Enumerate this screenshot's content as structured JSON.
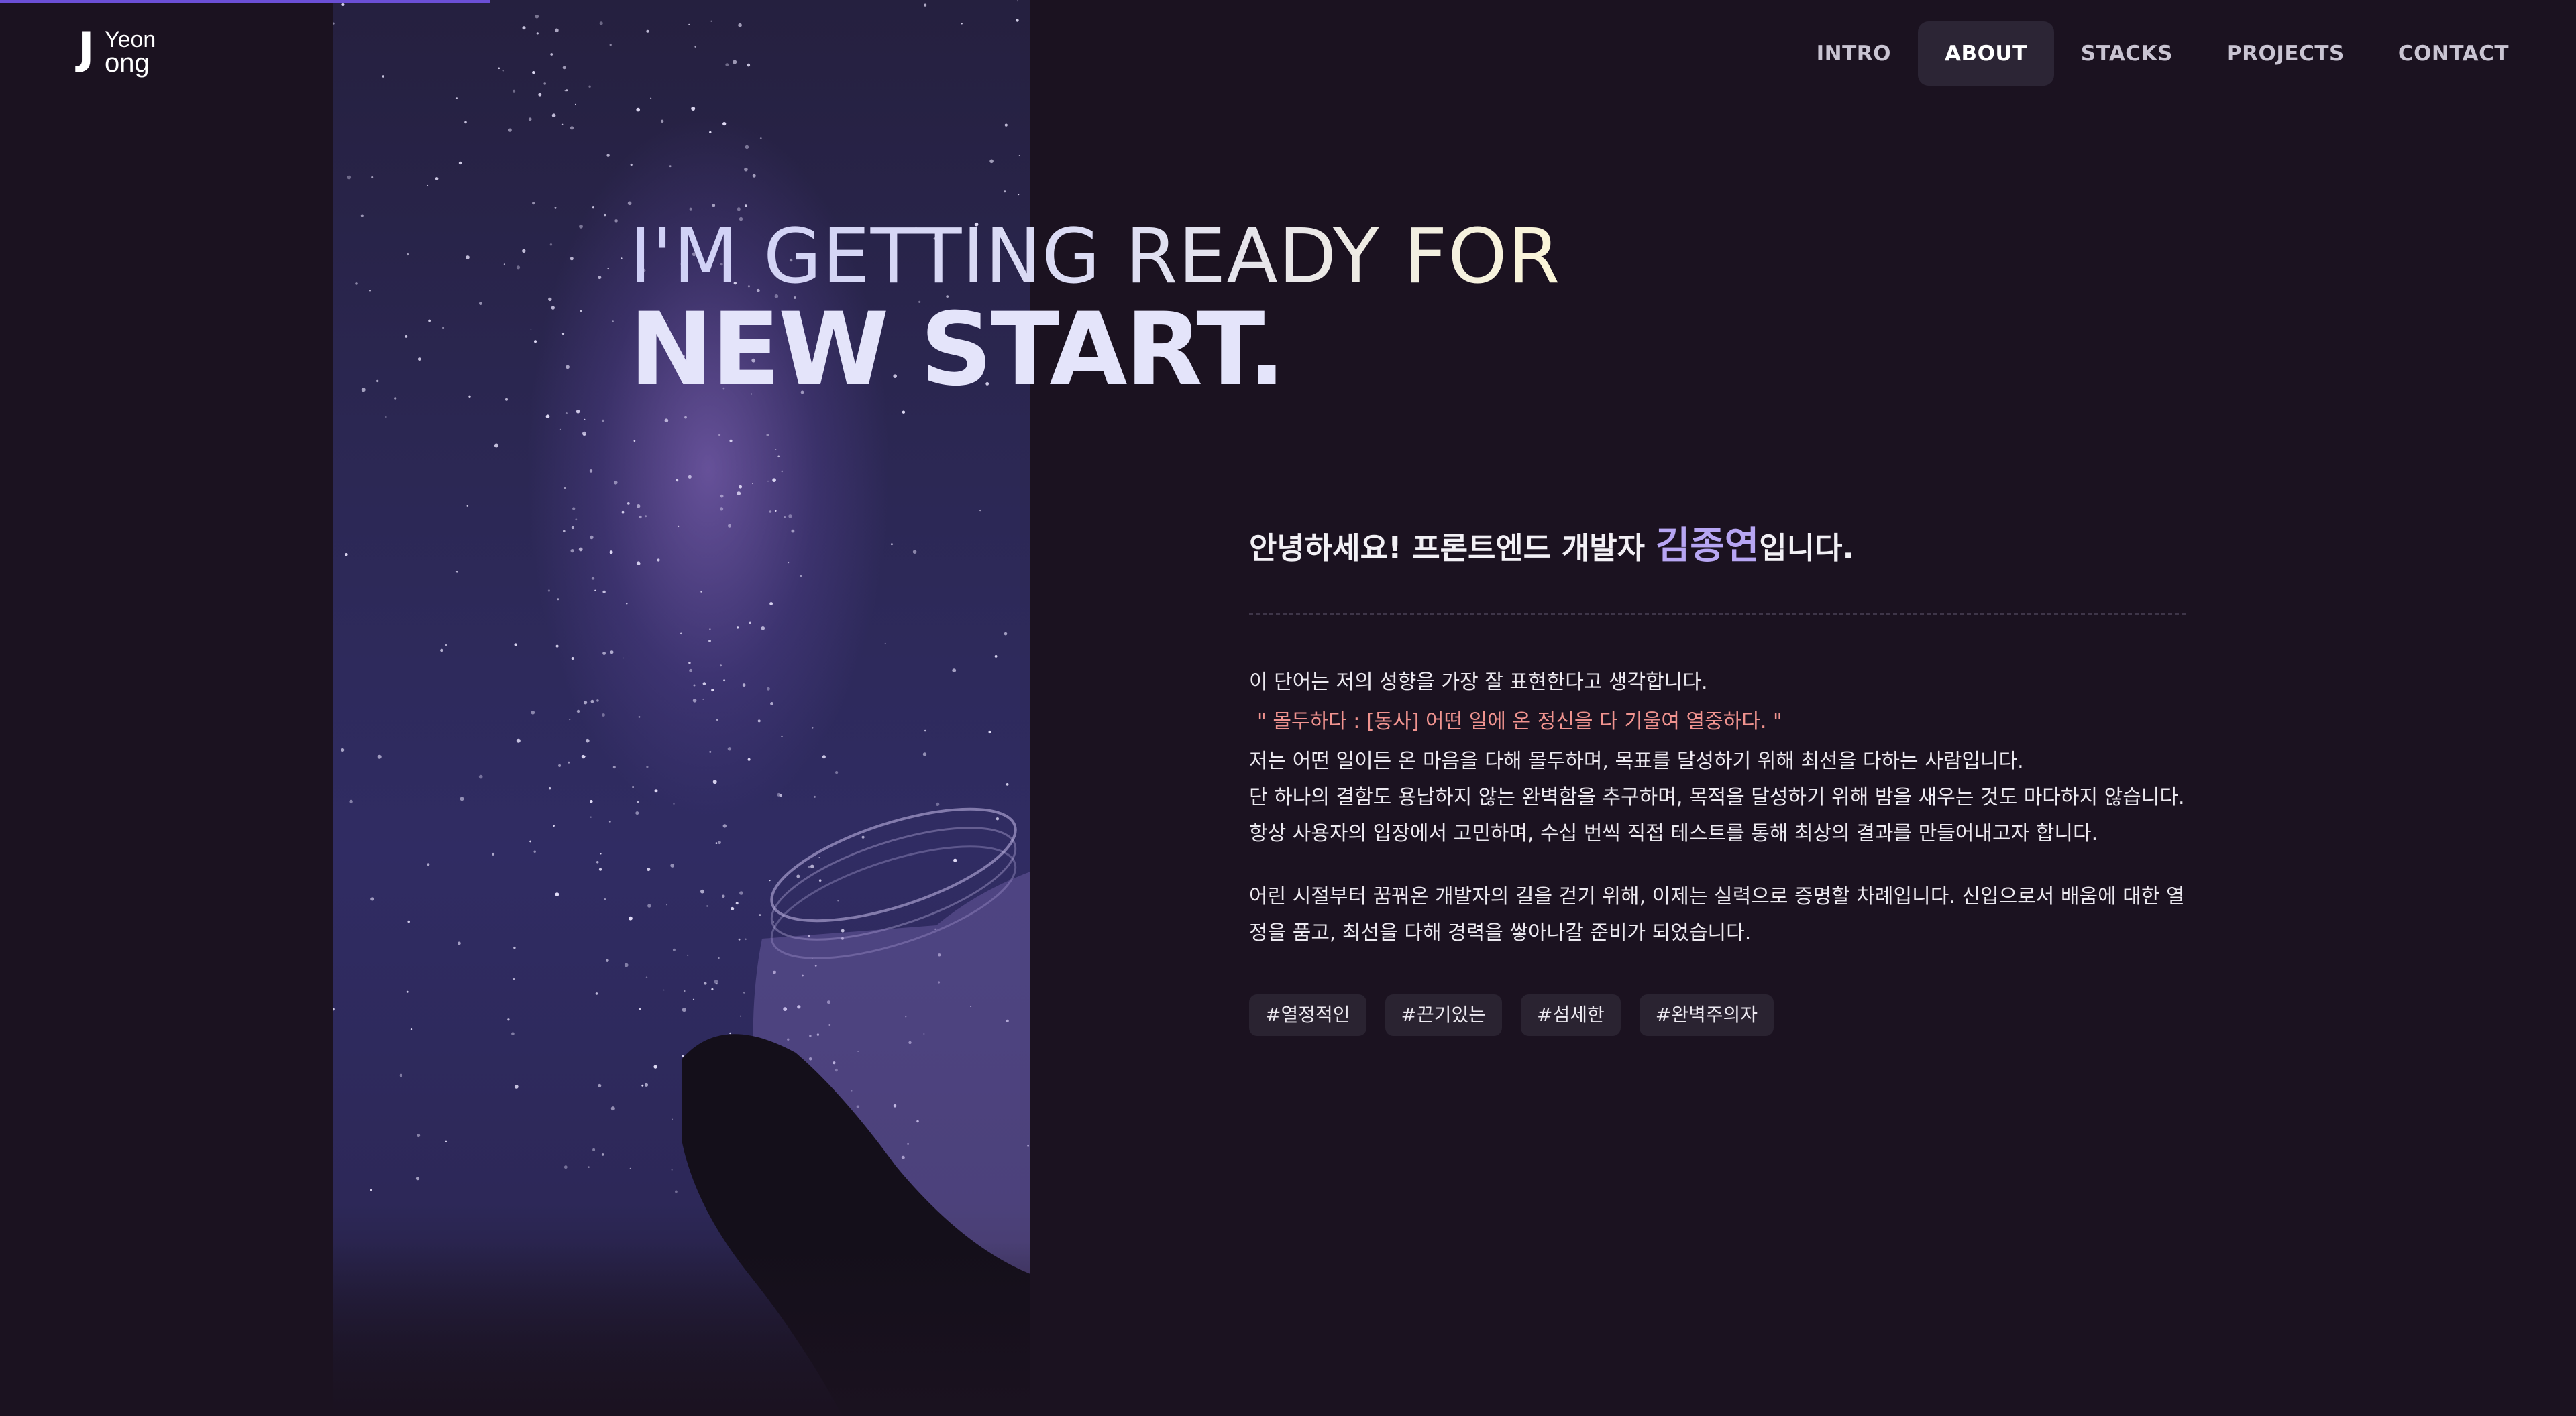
{
  "logo": {
    "big": "J",
    "top": "Yeon",
    "bottom": "ong"
  },
  "nav": {
    "items": [
      {
        "label": "INTRO",
        "active": false
      },
      {
        "label": "ABOUT",
        "active": true
      },
      {
        "label": "STACKS",
        "active": false
      },
      {
        "label": "PROJECTS",
        "active": false
      },
      {
        "label": "CONTACT",
        "active": false
      }
    ]
  },
  "hero": {
    "line1": "I'M GETTING READY FOR",
    "line2": "NEW START."
  },
  "about": {
    "greeting_prefix": "안녕하세요! 프론트엔드 개발자 ",
    "name": "김종연",
    "greeting_suffix": "입니다.",
    "lines": [
      "이 단어는 저의 성향을 가장 잘 표현한다고 생각합니다.",
      "\" 몰두하다 : [동사] 어떤 일에 온 정신을 다 기울여 열중하다. \"",
      "저는 어떤 일이든 온 마음을 다해 몰두하며, 목표를 달성하기 위해 최선을 다하는 사람입니다.",
      "단 하나의 결함도 용납하지 않는 완벽함을 추구하며, 목적을 달성하기 위해 밤을 새우는 것도 마다하지 않습니다.",
      "항상 사용자의 입장에서 고민하며, 수십 번씩 직접 테스트를 통해 최상의 결과를 만들어내고자 합니다."
    ],
    "paragraph2": [
      "어린 시절부터 꿈꿔온 개발자의 길을 걷기 위해, 이제는 실력으로 증명할 차례입니다. 신입으로서 배움에 대한 열",
      "정을 품고, 최선을 다해 경력을 쌓아나갈 준비가 되었습니다."
    ],
    "tags": [
      "#열정적인",
      "#끈기있는",
      "#섬세한",
      "#완벽주의자"
    ]
  },
  "colors": {
    "background": "#1b1220",
    "accent": "#6b4fd6",
    "name_highlight": "#b7a6f3",
    "quote": "#f0938f",
    "nav_active_bg": "#2c2535"
  },
  "progress": {
    "fraction": 0.19
  }
}
